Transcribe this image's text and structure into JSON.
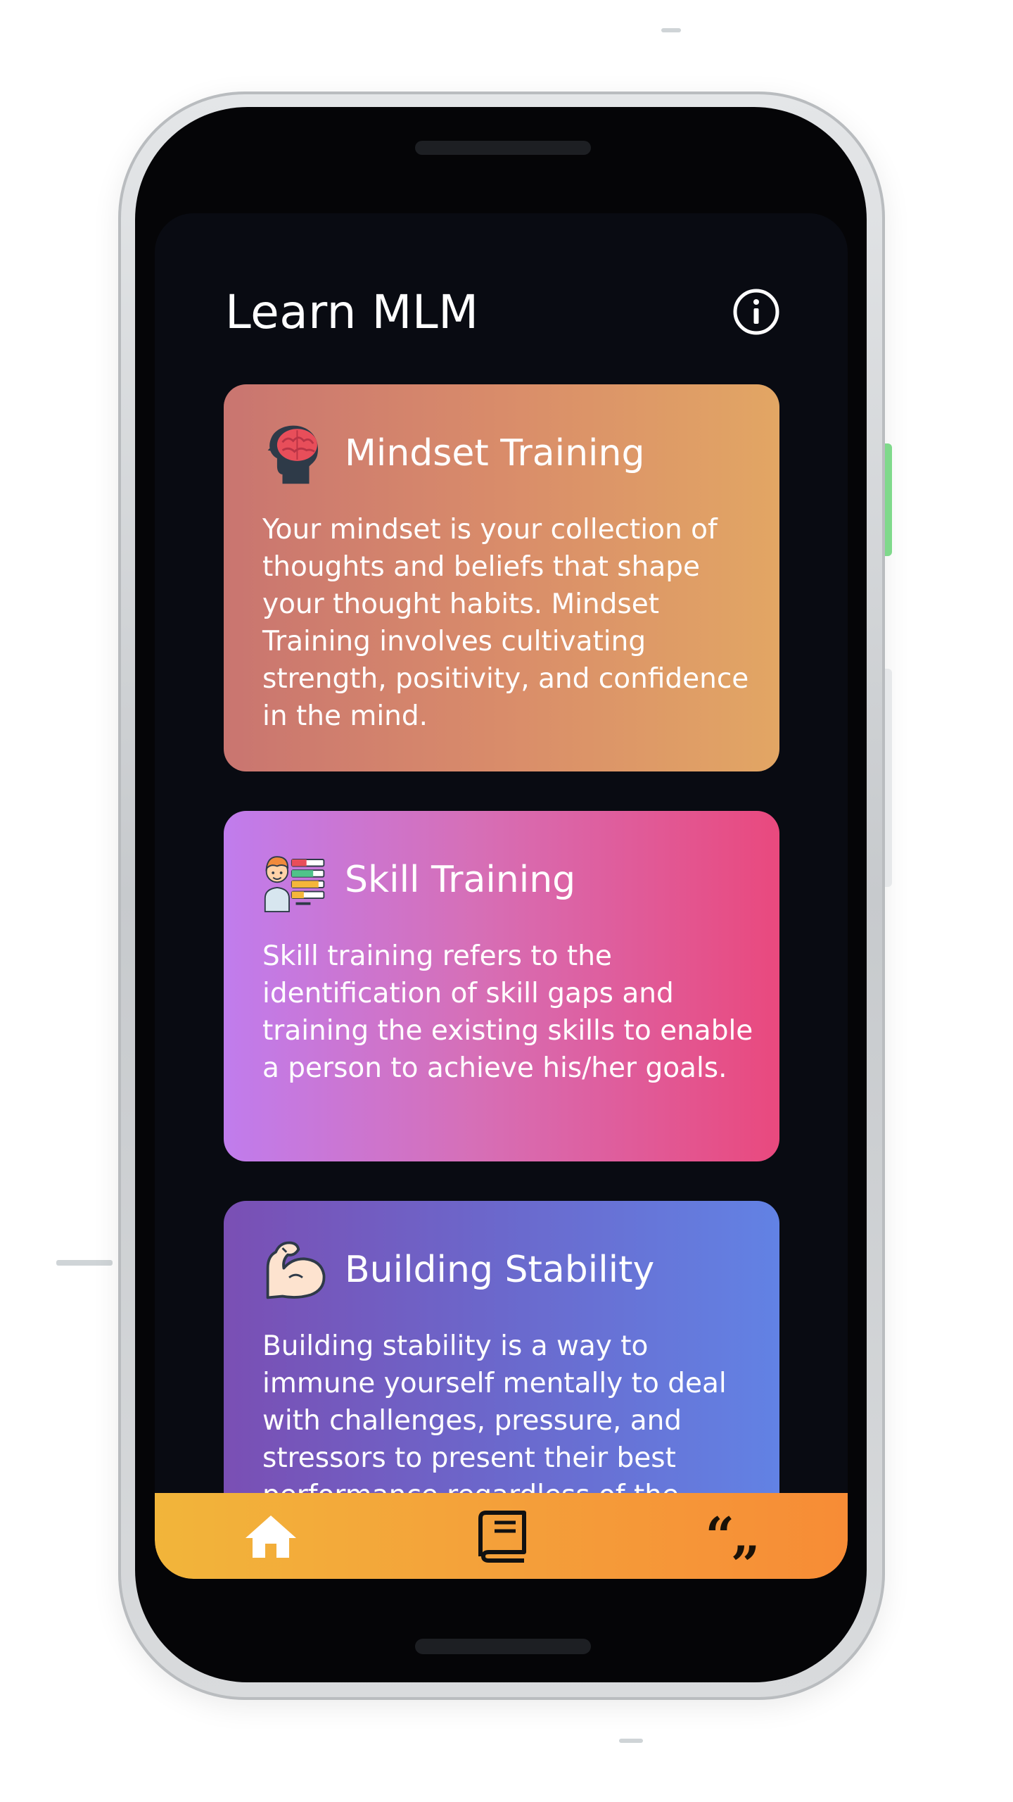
{
  "app": {
    "title": "Learn MLM",
    "info_icon": "info-circle-icon"
  },
  "cards": [
    {
      "icon": "brain-head-icon",
      "title": "Mindset Training",
      "body": "Your mindset is your collection of thoughts and beliefs that shape your thought habits. Mindset Training involves cultivating strength, positivity, and confidence in the mind.",
      "gradient": [
        "#c97570",
        "#e2a664"
      ]
    },
    {
      "icon": "trainer-skills-icon",
      "title": "Skill Training",
      "body": "Skill training refers to the identification of skill gaps and training the existing skills to enable a person to achieve his/her goals.",
      "gradient": [
        "#c07ced",
        "#e9497e"
      ]
    },
    {
      "icon": "flexed-arm-icon",
      "title": "Building Stability",
      "body": "Building stability is a way to immune yourself mentally to deal with challenges, pressure, and stressors to present their best performance regardless of the",
      "gradient": [
        "#7a4fb4",
        "#6282e4"
      ]
    }
  ],
  "bottom_nav": {
    "items": [
      {
        "name": "home",
        "icon": "home-icon"
      },
      {
        "name": "book",
        "icon": "book-icon"
      },
      {
        "name": "quotes",
        "icon": "quote-icon",
        "glyph": "“„"
      }
    ],
    "gradient": [
      "#f2b53a",
      "#f78c36"
    ]
  },
  "colors": {
    "screen_background": "#090b12",
    "text": "#ffffff"
  }
}
